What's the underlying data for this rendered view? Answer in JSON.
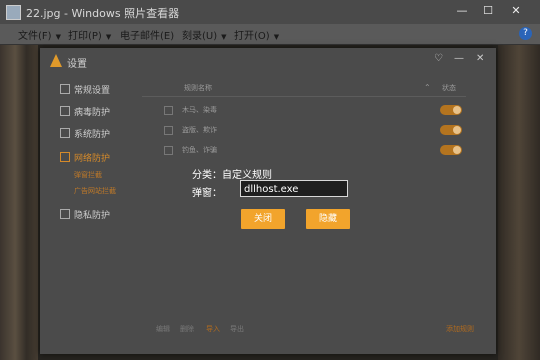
{
  "window": {
    "title": "22.jpg - Windows 照片查看器",
    "controls": {
      "minimize": "—",
      "maximize": "☐",
      "close": "✕"
    }
  },
  "menubar": {
    "items": [
      "文件(F)",
      "打印(P)",
      "电子邮件(E)",
      "刻录(U)",
      "打开(O)"
    ],
    "help": "?"
  },
  "dialog": {
    "title": "设置",
    "controls": {
      "pin": "♡",
      "minimize": "—",
      "close": "✕"
    },
    "nav": [
      {
        "label": "常规设置"
      },
      {
        "label": "病毒防护"
      },
      {
        "label": "系统防护"
      },
      {
        "label": "网络防护",
        "active": true
      },
      {
        "label": "隐私防护"
      }
    ],
    "nav_sub": [
      "弹窗拦截",
      "广告网站拦截"
    ],
    "table": {
      "headers": [
        "规则名称",
        "状态"
      ],
      "rows": [
        "木马、染毒",
        "盗版、欺诈",
        "钓鱼、诈骗"
      ]
    },
    "bottom_links": [
      "编辑",
      "删除",
      "导入",
      "导出"
    ],
    "add_rule": "添加规则"
  },
  "popup": {
    "category_label": "分类：",
    "category_value": "自定义规则",
    "popup_label": "弹窗：",
    "input_value": "dllhost.exe",
    "close_button": "关闭",
    "hide_button": "隐藏"
  },
  "colors": {
    "accent": "#f2a42c",
    "toggle": "#b4741f"
  }
}
